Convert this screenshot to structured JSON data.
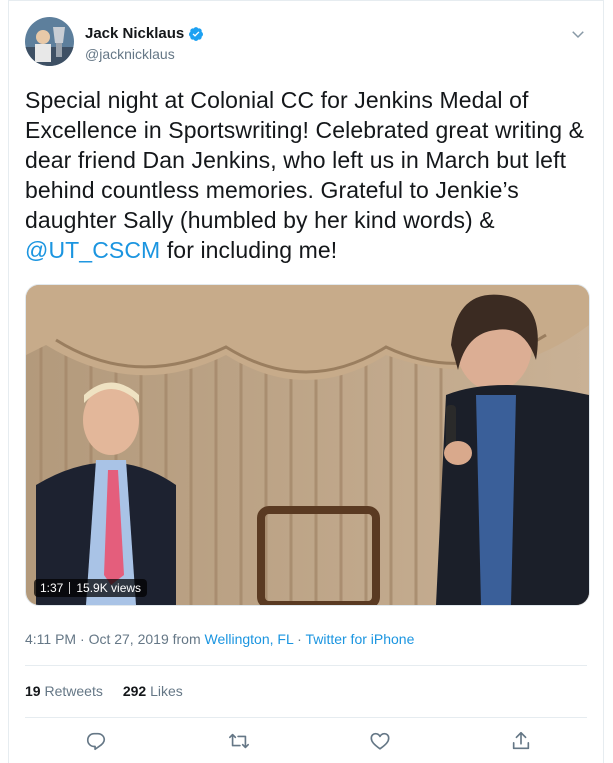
{
  "author": {
    "name": "Jack Nicklaus",
    "handle": "@jacknicklaus",
    "verified_icon": "verified-badge-icon",
    "accent": "#1da1f2"
  },
  "tweet": {
    "text_parts": [
      "Special night at Colonial CC for Jenkins Medal of Excellence in Sportswriting! Celebrated great writing & dear friend Dan Jenkins, who left us in March but left behind countless memories. Grateful to Jenkie’s daughter Sally (humbled by her kind words) & ",
      "@UT_CSCM",
      " for including me!"
    ]
  },
  "media": {
    "duration": "1:37",
    "views": "15.9K views"
  },
  "meta": {
    "time": "4:11 PM",
    "sep1": " · ",
    "date": "Oct 27, 2019",
    "from_label": " from ",
    "location": "Wellington, FL",
    "sep2": " · ",
    "source": "Twitter for iPhone"
  },
  "stats": {
    "retweets_count": "19",
    "retweets_label": "Retweets",
    "likes_count": "292",
    "likes_label": "Likes"
  },
  "actions": [
    "reply-icon",
    "retweet-icon",
    "like-icon",
    "share-icon"
  ]
}
